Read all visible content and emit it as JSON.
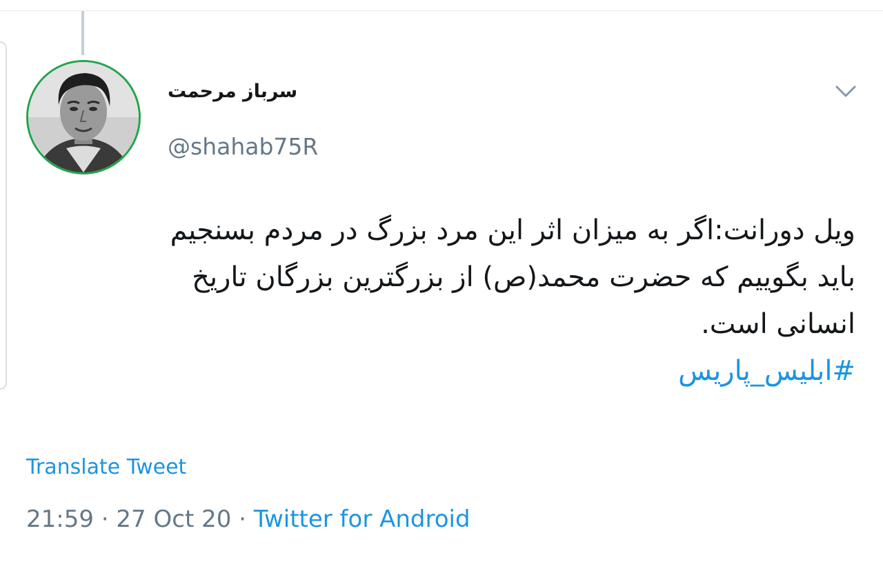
{
  "tweet": {
    "author": {
      "display_name": "سرباز مرحمت",
      "handle": "@shahab75R",
      "avatar_ring_color": "#1ea64a"
    },
    "menu_icon": "chevron-down-icon",
    "body_lines": [
      "ویل دورانت:اگر به میزان اثر این مرد بزرگ در مردم بسنجیم",
      "باید بگوییم که حضرت محمد(ص) از بزرگترین بزرگان تاریخ",
      "انسانی است."
    ],
    "hashtag": "#ابلیس_پاریس",
    "translate_label": "Translate Tweet",
    "time": "21:59",
    "separator": "·",
    "date": "27 Oct 20",
    "source": "Twitter for Android",
    "link_color": "#1b95e0",
    "muted_color": "#657786"
  }
}
